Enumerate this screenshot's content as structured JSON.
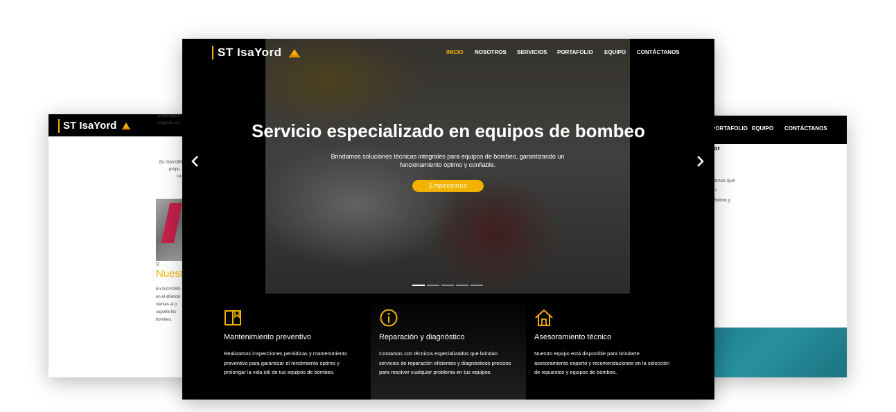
{
  "left_mockup": {
    "brand": "ST IsaYord",
    "text_lines": [
      "contáctanos",
      "segunda a s",
      "En ISAYORD",
      "propo",
      "ca"
    ],
    "small_caption": "Q",
    "heading": "Nuest",
    "body_lines": [
      "En ISAYORD",
      "en el afiancio",
      "cientes al p",
      "soporte téc",
      "bombeo."
    ]
  },
  "right_mockup": {
    "nav": [
      "PORTAFOLIO",
      "EQUIPO",
      "CONTÁCTANOS"
    ],
    "heading_fragment": "or",
    "text_lines": [
      "amos que",
      "n",
      "áximo y"
    ]
  },
  "main": {
    "brand": "ST IsaYord",
    "nav": [
      {
        "label": "INICIO",
        "active": true
      },
      {
        "label": "NOSOTROS",
        "active": false
      },
      {
        "label": "SERVICIOS",
        "active": false
      },
      {
        "label": "PORTAFOLIO",
        "active": false
      },
      {
        "label": "EQUIPO",
        "active": false
      },
      {
        "label": "CONTÁCTANOS",
        "active": false
      }
    ],
    "hero": {
      "title": "Servicio especializado en equipos de bombeo",
      "subtitle": "Brindamos soluciones técnicas integrales para equipos de bombeo, garantizando un funcionamiento óptimo y confiable.",
      "cta": "Empecemos",
      "prev_icon": "chevron-left-icon",
      "next_icon": "chevron-right-icon",
      "slide_count": 5,
      "active_slide": 1
    },
    "features": [
      {
        "icon": "book-icon",
        "title": "Mantenimiento preventivo",
        "text": "Realizamos inspecciones periódicas y mantenimiento preventivo para garantizar el rendimiento óptimo y prolongar la vida útil de tus equipos de bombeo."
      },
      {
        "icon": "info-icon",
        "title": "Reparación y diagnóstico",
        "text": "Contamos con técnicos especializados que brindan servicios de reparación eficientes y diagnósticos precisos para resolver cualquier problema en tus equipos."
      },
      {
        "icon": "home-icon",
        "title": "Asesoramiento técnico",
        "text": "Nuestro equipo está disponible para brindarte asesoramiento experto y recomendaciones en la selección de repuestos y equipos de bombeo."
      }
    ],
    "accent_color": "#f3b300"
  }
}
